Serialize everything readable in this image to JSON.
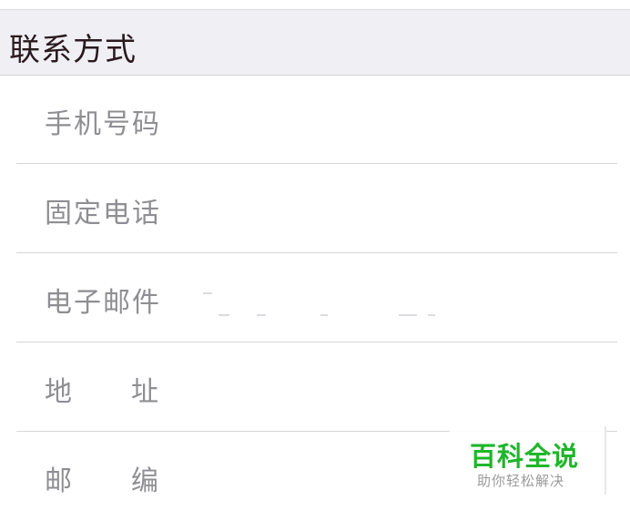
{
  "section": {
    "title": "联系方式"
  },
  "fields": [
    {
      "label": "手机号码",
      "value": ""
    },
    {
      "label": "固定电话",
      "value": ""
    },
    {
      "label": "电子邮件",
      "value": ""
    },
    {
      "label_part1": "地",
      "label_part2": "址",
      "value": ""
    },
    {
      "label_part1": "邮",
      "label_part2": "编",
      "value": ""
    }
  ],
  "watermark": {
    "title": "百科全说",
    "subtitle": "助你轻松解决"
  },
  "colors": {
    "header_bg": "#efeff4",
    "label": "#8e8e93",
    "brand_green": "#1fb62a"
  }
}
